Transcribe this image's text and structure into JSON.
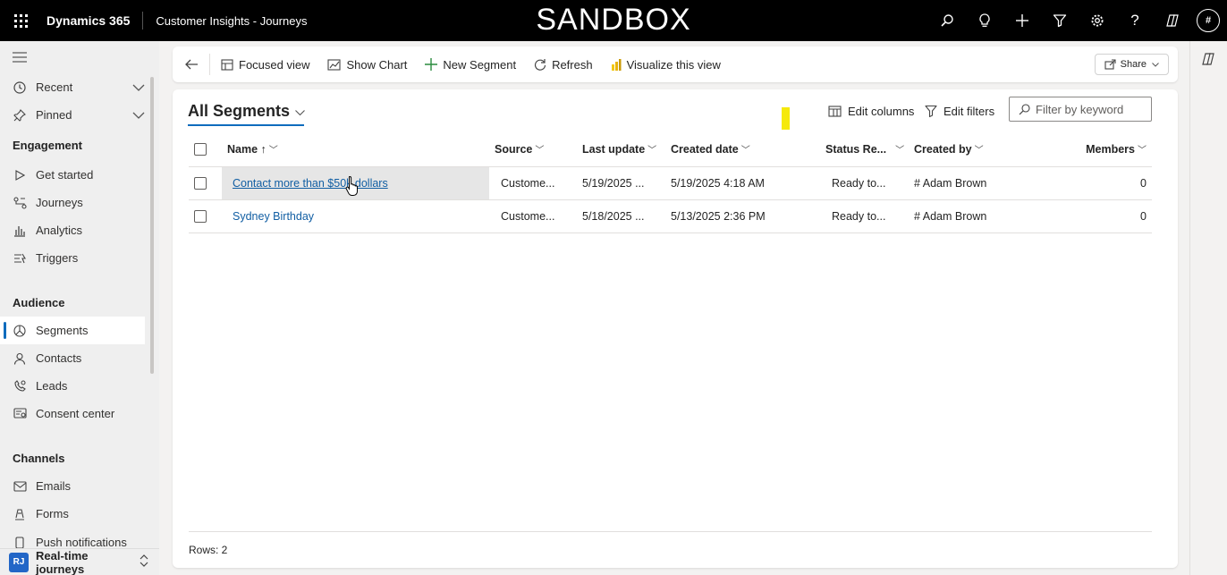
{
  "topbar": {
    "app_name": "Dynamics 365",
    "area_name": "Customer Insights - Journeys",
    "banner": "SANDBOX",
    "avatar_initial": "#",
    "icons": [
      "search-icon",
      "lightbulb-icon",
      "plus-icon",
      "filter-icon",
      "gear-icon",
      "help-icon",
      "copilot-icon"
    ]
  },
  "sidebar": {
    "recent": "Recent",
    "pinned": "Pinned",
    "sections": {
      "engagement": "Engagement",
      "audience": "Audience",
      "channels": "Channels"
    },
    "engagement_items": [
      "Get started",
      "Journeys",
      "Analytics",
      "Triggers"
    ],
    "audience_items": [
      "Segments",
      "Contacts",
      "Leads",
      "Consent center"
    ],
    "channel_items": [
      "Emails",
      "Forms",
      "Push notifications"
    ],
    "area_switcher": {
      "initials": "RJ",
      "label": "Real-time journeys"
    }
  },
  "commands": {
    "focused_view": "Focused view",
    "show_chart": "Show Chart",
    "new_segment": "New Segment",
    "refresh": "Refresh",
    "visualize": "Visualize this view",
    "share": "Share"
  },
  "view": {
    "title": "All Segments",
    "edit_columns": "Edit columns",
    "edit_filters": "Edit filters",
    "filter_placeholder": "Filter by keyword",
    "columns": {
      "name": "Name",
      "name_sort": "↑",
      "source": "Source",
      "last_update": "Last update",
      "created_date": "Created date",
      "status": "Status Re...",
      "created_by": "Created by",
      "members": "Members"
    },
    "rows": [
      {
        "name": "Contact more than $50k dollars",
        "source": "Custome...",
        "last_update": "5/19/2025 ...",
        "created_date": "5/19/2025 4:18 AM",
        "status": "Ready to...",
        "created_by": "# Adam Brown",
        "members": "0"
      },
      {
        "name": "Sydney Birthday",
        "source": "Custome...",
        "last_update": "5/18/2025 ...",
        "created_date": "5/13/2025 2:36 PM",
        "status": "Ready to...",
        "created_by": "# Adam Brown",
        "members": "0"
      }
    ],
    "footer": "Rows: 2"
  },
  "colors": {
    "accent": "#0f6cbd",
    "link": "#115ea3",
    "topbar": "#000000",
    "highlight": "#f5e90b"
  }
}
